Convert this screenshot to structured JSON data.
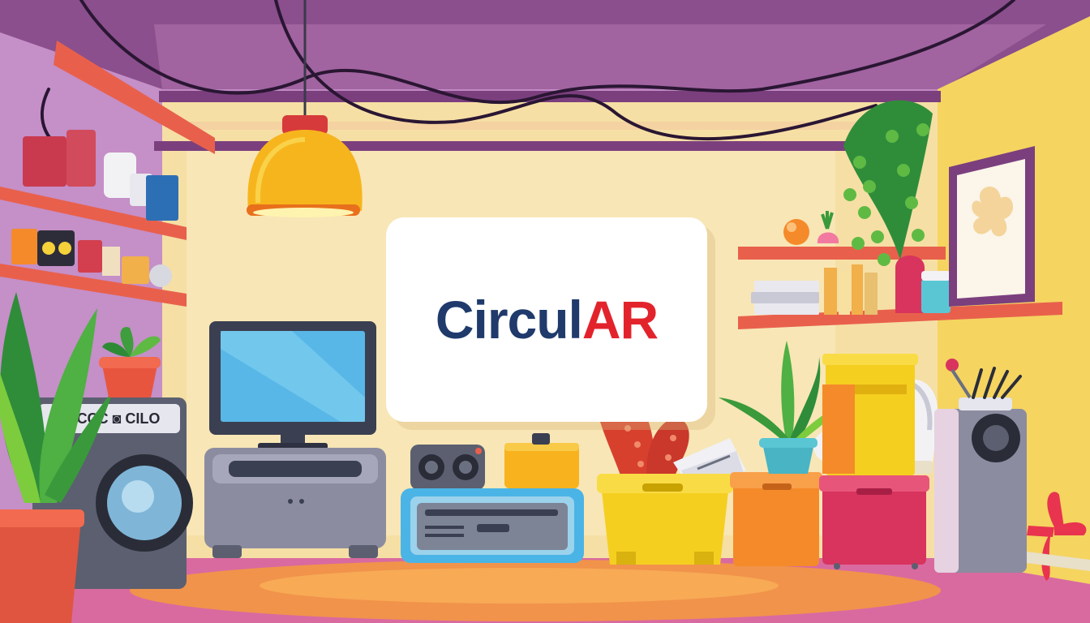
{
  "logo": {
    "part_a": "Circul",
    "part_b": "AR",
    "color_part_a": "#1f3a6b",
    "color_part_b": "#e3232c"
  },
  "colors": {
    "ceiling": "#8a4f8c",
    "back_wall": "#f6dfa4",
    "right_wall": "#f5d460",
    "left_wall": "#c08ac4",
    "floor": "#d96aa0",
    "floor_glow": "#f59a3c",
    "shelf": "#e8604c"
  },
  "scene": {
    "objects": [
      "ceiling-cables",
      "pendant-lamp",
      "left-wall-shelves",
      "washing-machine",
      "potted-plant-left",
      "small-potted-plant",
      "tv-monitor",
      "tv-cabinet",
      "speaker-console",
      "blue-dvd-player",
      "yellow-box",
      "red-gloves",
      "yellow-crate",
      "orange-crate",
      "pink-crate",
      "robot-vacuum-model",
      "potted-plant-right",
      "right-wall-shelves",
      "hanging-plant",
      "framed-picture",
      "floor-speaker",
      "red-fan"
    ]
  }
}
